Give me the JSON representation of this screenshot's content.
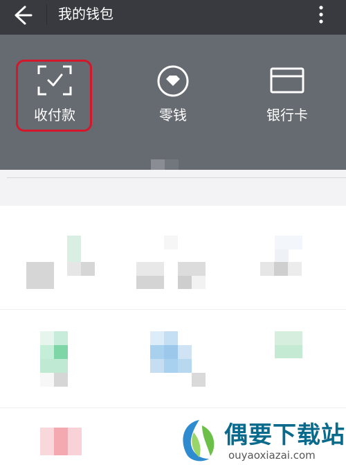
{
  "header": {
    "title": "我的钱包"
  },
  "wallet_actions": [
    {
      "label": "收付款",
      "icon": "scan-icon"
    },
    {
      "label": "零钱",
      "icon": "change-icon"
    },
    {
      "label": "银行卡",
      "icon": "bank-card-icon"
    }
  ],
  "watermark": {
    "name": "偶要下载站",
    "url": "ouyaoxiazai.com"
  },
  "colors": {
    "topbar": "#393a3f",
    "banner": "#666a71",
    "highlight": "#d4172b"
  }
}
